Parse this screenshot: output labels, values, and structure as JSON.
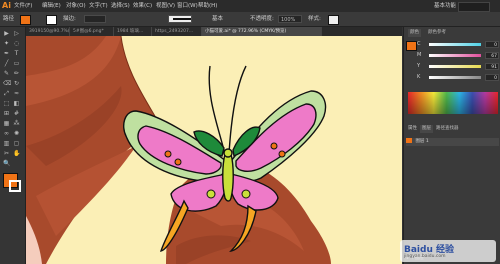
{
  "app": {
    "logo": "Ai"
  },
  "menu": [
    "文件(F)",
    "编辑(E)",
    "对象(O)",
    "文字(T)",
    "选择(S)",
    "效果(C)",
    "视图(V)",
    "窗口(W)",
    "帮助(H)"
  ],
  "workspace": "基本功能",
  "control": {
    "selection_label": "路径",
    "stroke_label": "描边:",
    "brush_label": "基本",
    "opacity_label": "不透明度:",
    "opacity_value": "100%",
    "style_label": "样式:",
    "fill_color": "#f07316",
    "stroke_color": "#1a1a1a"
  },
  "tabs": [
    "3919150@90.7%(R)",
    "5#图@6.png*",
    "1984 玻璃...",
    "https_2493207...",
    "小猫可爱.ai* @ 772.96% (CMYK/预览)"
  ],
  "toolbox": {
    "tools": [
      "selection-tool-icon",
      "direct-selection-tool-icon",
      "magic-wand-icon",
      "lasso-icon",
      "pen-tool-icon",
      "type-tool-icon",
      "line-tool-icon",
      "rectangle-tool-icon",
      "paintbrush-icon",
      "pencil-icon",
      "eraser-icon",
      "rotate-tool-icon",
      "scale-tool-icon",
      "width-tool-icon",
      "free-transform-icon",
      "shape-builder-icon",
      "perspective-grid-icon",
      "mesh-tool-icon",
      "gradient-tool-icon",
      "eyedropper-icon",
      "blend-tool-icon",
      "symbol-sprayer-icon",
      "column-graph-icon",
      "artboard-tool-icon",
      "slice-tool-icon",
      "hand-tool-icon",
      "zoom-tool-icon"
    ],
    "fill_color": "#f07316",
    "stroke_color": "#ffffff"
  },
  "panels": {
    "color_tab": "颜色",
    "guide_tab": "颜色参考",
    "sliders": [
      {
        "label": "C",
        "value": "0",
        "color": "#4fd1e6"
      },
      {
        "label": "M",
        "value": "67",
        "color": "#e04f9b"
      },
      {
        "label": "Y",
        "value": "91",
        "color": "#e6d94f"
      },
      {
        "label": "K",
        "value": "0",
        "color": "#888888"
      }
    ],
    "layers_tabs": [
      "属性",
      "图层",
      "路径查找器"
    ],
    "layer_name": "图层 1",
    "layer_count": "1 个图层"
  },
  "watermark": {
    "text": "Baidu 经验",
    "sub": "jingyan.baidu.com"
  }
}
